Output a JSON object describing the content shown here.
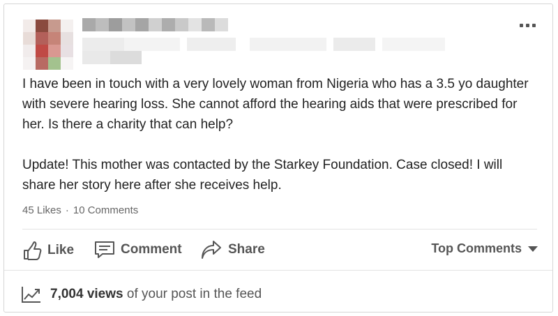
{
  "post": {
    "author_name_redacted": true,
    "paragraphs": [
      "I have been in touch with a very lovely woman from Nigeria who has a 3.5 yo daughter with severe hearing loss. She cannot afford the hearing aids that were prescribed for her. Is there a charity that can help?",
      "Update! This mother was contacted by the Starkey Foundation. Case closed! I will share her story here after she receives help."
    ]
  },
  "counts": {
    "likes": "45 Likes",
    "separator": "·",
    "comments": "10 Comments"
  },
  "actions": {
    "like": "Like",
    "comment": "Comment",
    "share": "Share",
    "sort": "Top Comments"
  },
  "views": {
    "count": "7,004 views",
    "suffix": " of your post in the feed"
  },
  "icons": {
    "more": "more-dots-icon",
    "like": "thumbs-up-icon",
    "comment": "comment-bubble-icon",
    "share": "share-arrow-icon",
    "sort": "caret-down-icon",
    "views": "trending-chart-icon"
  },
  "colors": {
    "text": "#222222",
    "muted": "#666666",
    "action": "#555555",
    "divider": "#e3e3e3"
  }
}
